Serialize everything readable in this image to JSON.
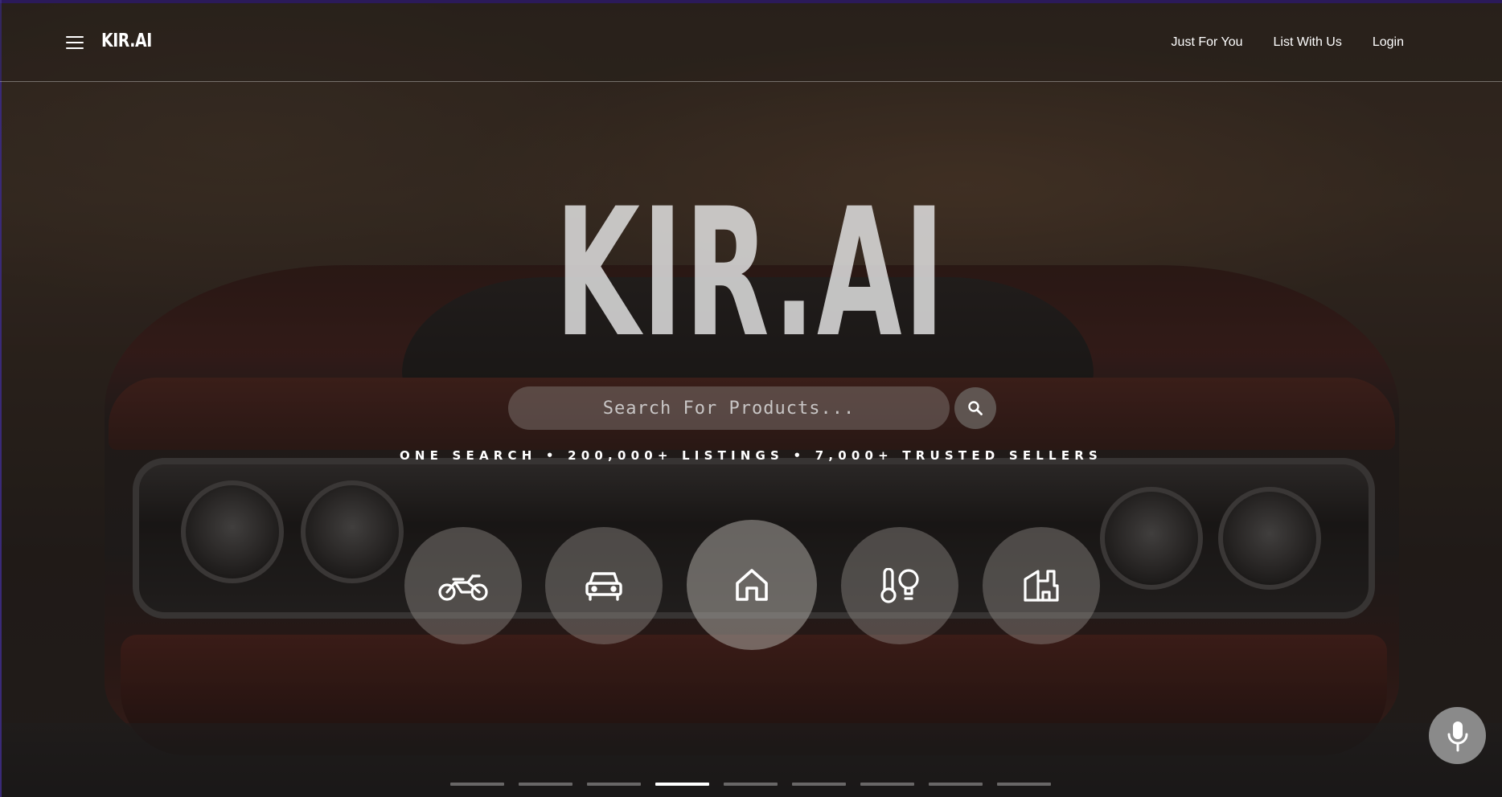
{
  "header": {
    "logo_text": "KIR.AI",
    "nav": [
      {
        "label": "Just For You"
      },
      {
        "label": "List With Us"
      },
      {
        "label": "Login"
      }
    ]
  },
  "hero": {
    "title": "KIR.AI",
    "search": {
      "placeholder": "Search For Products..."
    },
    "tagline": "ONE SEARCH • 200,000+ LISTINGS • 7,000+ TRUSTED SELLERS"
  },
  "categories": [
    {
      "icon": "motorcycle-icon",
      "active": false
    },
    {
      "icon": "car-icon",
      "active": false
    },
    {
      "icon": "home-icon",
      "active": true
    },
    {
      "icon": "thermometer-lightbulb-icon",
      "active": false
    },
    {
      "icon": "commercial-property-icon",
      "active": false
    }
  ],
  "carousel": {
    "count": 9,
    "active_index": 3
  },
  "colors": {
    "accent": "#2b1a5a",
    "text": "#ffffff",
    "mic_button": "#8a8a8a"
  }
}
